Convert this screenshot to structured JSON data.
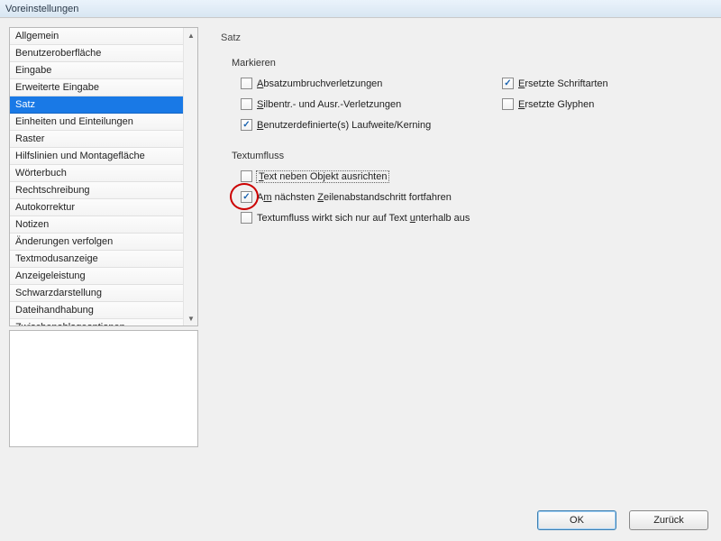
{
  "window": {
    "title": "Voreinstellungen"
  },
  "sidebar": {
    "items": [
      {
        "label": "Allgemein"
      },
      {
        "label": "Benutzeroberfläche"
      },
      {
        "label": "Eingabe"
      },
      {
        "label": "Erweiterte Eingabe"
      },
      {
        "label": "Satz",
        "selected": true
      },
      {
        "label": "Einheiten und Einteilungen"
      },
      {
        "label": "Raster"
      },
      {
        "label": "Hilfslinien und Montagefläche"
      },
      {
        "label": "Wörterbuch"
      },
      {
        "label": "Rechtschreibung"
      },
      {
        "label": "Autokorrektur"
      },
      {
        "label": "Notizen"
      },
      {
        "label": "Änderungen verfolgen"
      },
      {
        "label": "Textmodusanzeige"
      },
      {
        "label": "Anzeigeleistung"
      },
      {
        "label": "Schwarzdarstellung"
      },
      {
        "label": "Dateihandhabung"
      },
      {
        "label": "Zwischenablageoptionen"
      }
    ]
  },
  "page": {
    "title": "Satz",
    "sections": {
      "markieren": {
        "title": "Markieren",
        "opts": {
          "absatz": {
            "label": "Absatzumbruchverletzungen",
            "checked": false
          },
          "schrift": {
            "label": "Ersetzte Schriftarten",
            "checked": true
          },
          "silben": {
            "label": "Silbentr.- und Ausr.-Verletzungen",
            "checked": false
          },
          "glyphen": {
            "label": "Ersetzte Glyphen",
            "checked": false
          },
          "kerning": {
            "label": "Benutzerdefinierte(s) Laufweite/Kerning",
            "checked": true
          }
        }
      },
      "textumfluss": {
        "title": "Textumfluss",
        "opts": {
          "neben": {
            "label": "Text neben Objekt ausrichten",
            "checked": false,
            "focused": true
          },
          "zeilen": {
            "label": "Am nächsten Zeilenabstandschritt fortfahren",
            "checked": true,
            "circled": true
          },
          "unter": {
            "label": "Textumfluss wirkt sich nur auf Text unterhalb aus",
            "checked": false
          }
        }
      }
    }
  },
  "buttons": {
    "ok": "OK",
    "back": "Zurück"
  }
}
